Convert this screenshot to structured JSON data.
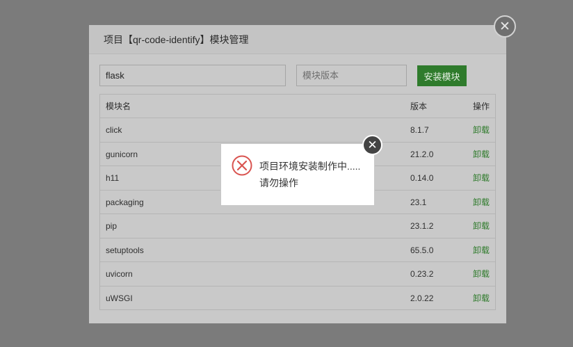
{
  "dialog": {
    "title": "项目【qr-code-identify】模块管理",
    "close_icon": "✕"
  },
  "form": {
    "name_value": "flask",
    "version_placeholder": "模块版本",
    "install_label": "安装模块"
  },
  "table": {
    "headers": {
      "name": "模块名",
      "version": "版本",
      "action": "操作"
    },
    "rows": [
      {
        "name": "click",
        "version": "8.1.7",
        "action": "卸载"
      },
      {
        "name": "gunicorn",
        "version": "21.2.0",
        "action": "卸载"
      },
      {
        "name": "h11",
        "version": "0.14.0",
        "action": "卸载"
      },
      {
        "name": "packaging",
        "version": "23.1",
        "action": "卸载"
      },
      {
        "name": "pip",
        "version": "23.1.2",
        "action": "卸载"
      },
      {
        "name": "setuptools",
        "version": "65.5.0",
        "action": "卸载"
      },
      {
        "name": "uvicorn",
        "version": "0.23.2",
        "action": "卸载"
      },
      {
        "name": "uWSGI",
        "version": "2.0.22",
        "action": "卸载"
      }
    ]
  },
  "toast": {
    "line1": "项目环境安装制作中.....",
    "line2": "请勿操作",
    "icon": "error-icon",
    "close_icon": "✕"
  },
  "colors": {
    "accent_green": "#2f7b2c",
    "error_red": "#d9534f"
  }
}
